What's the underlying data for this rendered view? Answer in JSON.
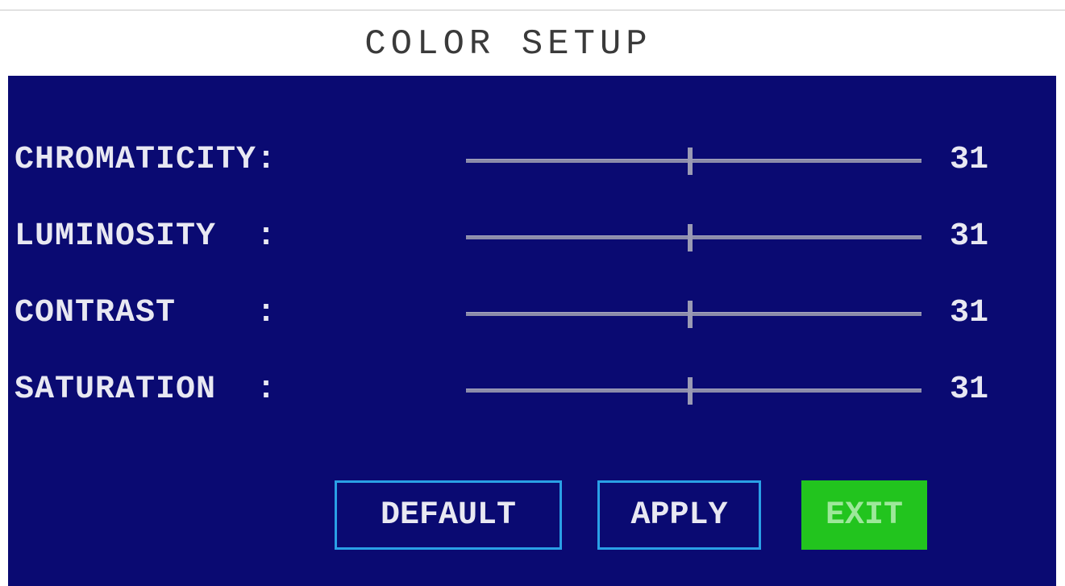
{
  "title": "COLOR SETUP",
  "settings": [
    {
      "label": "CHROMATICITY:",
      "value": "31",
      "level": 31
    },
    {
      "label": "LUMINOSITY  :",
      "value": "31",
      "level": 31
    },
    {
      "label": "CONTRAST    :",
      "value": "31",
      "level": 31
    },
    {
      "label": "SATURATION  :",
      "value": "31",
      "level": 31
    }
  ],
  "buttons": {
    "default_label": "DEFAULT",
    "apply_label": "APPLY",
    "exit_label": "EXIT"
  },
  "colors": {
    "panel_background": "#0a0a72",
    "button_border": "#2aa0e6",
    "exit_active": "#22c41e",
    "text": "#e8e8f2"
  }
}
